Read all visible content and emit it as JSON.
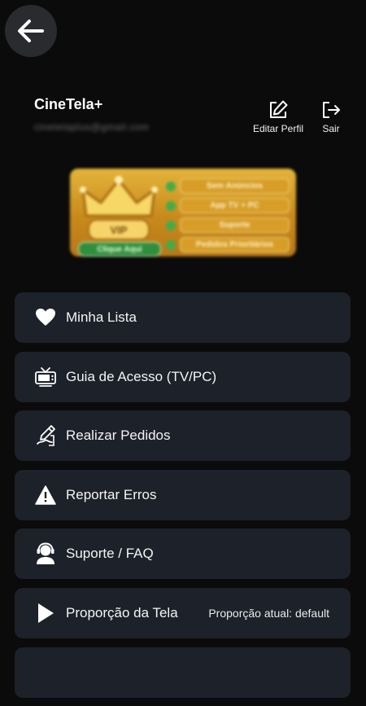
{
  "profile": {
    "name": "CineTela+",
    "email": "cinetelaplus@gmail.com"
  },
  "actions": {
    "edit_label": "Editar Perfil",
    "logout_label": "Sair"
  },
  "vip_banner": {
    "badge": "VIP",
    "cta": "Clique Aqui",
    "features": [
      "Sem Anúncios",
      "App TV + PC",
      "Suporte",
      "Pedidos Prioritários"
    ],
    "colors": {
      "gold": "#e3b43a",
      "green": "#3fae4a"
    }
  },
  "menu": {
    "items": [
      {
        "label": "Minha Lista",
        "icon": "heart-icon"
      },
      {
        "label": "Guia de Acesso (TV/PC)",
        "icon": "tv-icon"
      },
      {
        "label": "Realizar Pedidos",
        "icon": "edit-request-icon"
      },
      {
        "label": "Reportar Erros",
        "icon": "warning-icon"
      },
      {
        "label": "Suporte / FAQ",
        "icon": "support-agent-icon"
      },
      {
        "label": "Proporção da Tela",
        "icon": "play-icon",
        "value": "Proporção atual: default"
      }
    ]
  },
  "colors": {
    "background": "#0b0b0b",
    "card": "#1d2129",
    "back_button": "#2a2b2e"
  }
}
